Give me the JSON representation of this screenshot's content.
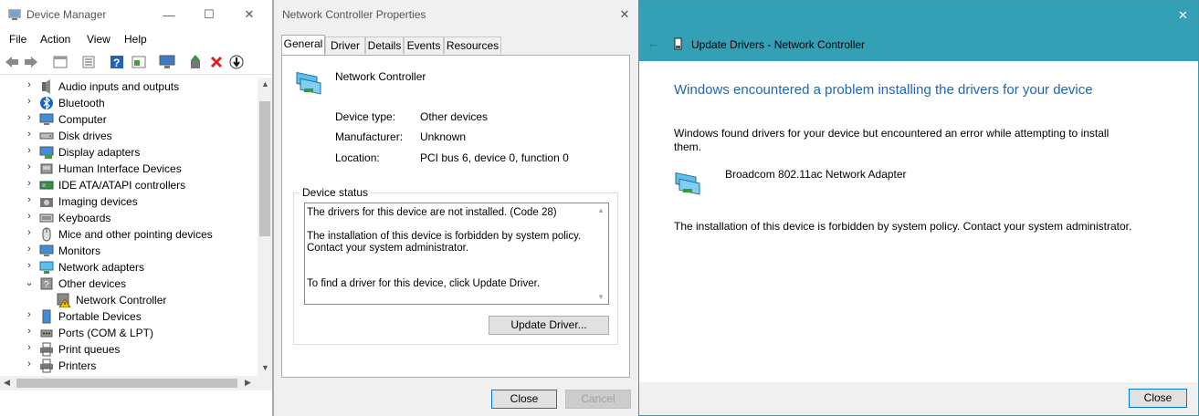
{
  "device_manager": {
    "title": "Device Manager",
    "menu": [
      "File",
      "Action",
      "View",
      "Help"
    ],
    "tree": [
      {
        "label": "Audio inputs and outputs",
        "expanded": false,
        "icon": "speaker-icon"
      },
      {
        "label": "Bluetooth",
        "expanded": false,
        "icon": "bluetooth-icon"
      },
      {
        "label": "Computer",
        "expanded": false,
        "icon": "monitor-icon"
      },
      {
        "label": "Disk drives",
        "expanded": false,
        "icon": "disk-icon"
      },
      {
        "label": "Display adapters",
        "expanded": false,
        "icon": "display-adapter-icon"
      },
      {
        "label": "Human Interface Devices",
        "expanded": false,
        "icon": "hid-icon"
      },
      {
        "label": "IDE ATA/ATAPI controllers",
        "expanded": false,
        "icon": "ide-icon"
      },
      {
        "label": "Imaging devices",
        "expanded": false,
        "icon": "camera-icon"
      },
      {
        "label": "Keyboards",
        "expanded": false,
        "icon": "keyboard-icon"
      },
      {
        "label": "Mice and other pointing devices",
        "expanded": false,
        "icon": "mouse-icon"
      },
      {
        "label": "Monitors",
        "expanded": false,
        "icon": "monitor-icon"
      },
      {
        "label": "Network adapters",
        "expanded": false,
        "icon": "network-adapter-icon"
      },
      {
        "label": "Other devices",
        "expanded": true,
        "icon": "unknown-device-icon"
      },
      {
        "label": "Network Controller",
        "child": true,
        "icon": "warning-device-icon"
      },
      {
        "label": "Portable Devices",
        "expanded": false,
        "icon": "portable-device-icon"
      },
      {
        "label": "Ports (COM & LPT)",
        "expanded": false,
        "icon": "port-icon"
      },
      {
        "label": "Print queues",
        "expanded": false,
        "icon": "printer-icon"
      },
      {
        "label": "Printers",
        "expanded": false,
        "icon": "printer-icon"
      }
    ]
  },
  "properties": {
    "title": "Network Controller Properties",
    "tabs": [
      "General",
      "Driver",
      "Details",
      "Events",
      "Resources"
    ],
    "active_tab": "General",
    "device_name": "Network Controller",
    "fields": [
      {
        "label": "Device type:",
        "value": "Other devices"
      },
      {
        "label": "Manufacturer:",
        "value": "Unknown"
      },
      {
        "label": "Location:",
        "value": "PCI bus 6, device 0, function 0"
      }
    ],
    "status_group_title": "Device status",
    "status_lines": [
      "The drivers for this device are not installed. (Code 28)",
      "",
      "The installation of this device is forbidden by system policy.",
      "Contact your system administrator.",
      "",
      "",
      "To find a driver for this device, click Update Driver."
    ],
    "update_driver_button": "Update Driver...",
    "close_button": "Close",
    "cancel_button": "Cancel"
  },
  "update_drivers": {
    "header_title": "Update Drivers - Network Controller",
    "heading": "Windows encountered a problem installing the drivers for your device",
    "message_line1": "Windows found drivers for your device but encountered an error while attempting to install",
    "message_line2": "them.",
    "adapter_name": "Broadcom 802.11ac Network Adapter",
    "policy_message": "The installation of this device is forbidden by system policy. Contact your system administrator.",
    "close_button": "Close",
    "colors": {
      "header": "#34a0b5",
      "heading_text": "#1e66b4"
    }
  }
}
